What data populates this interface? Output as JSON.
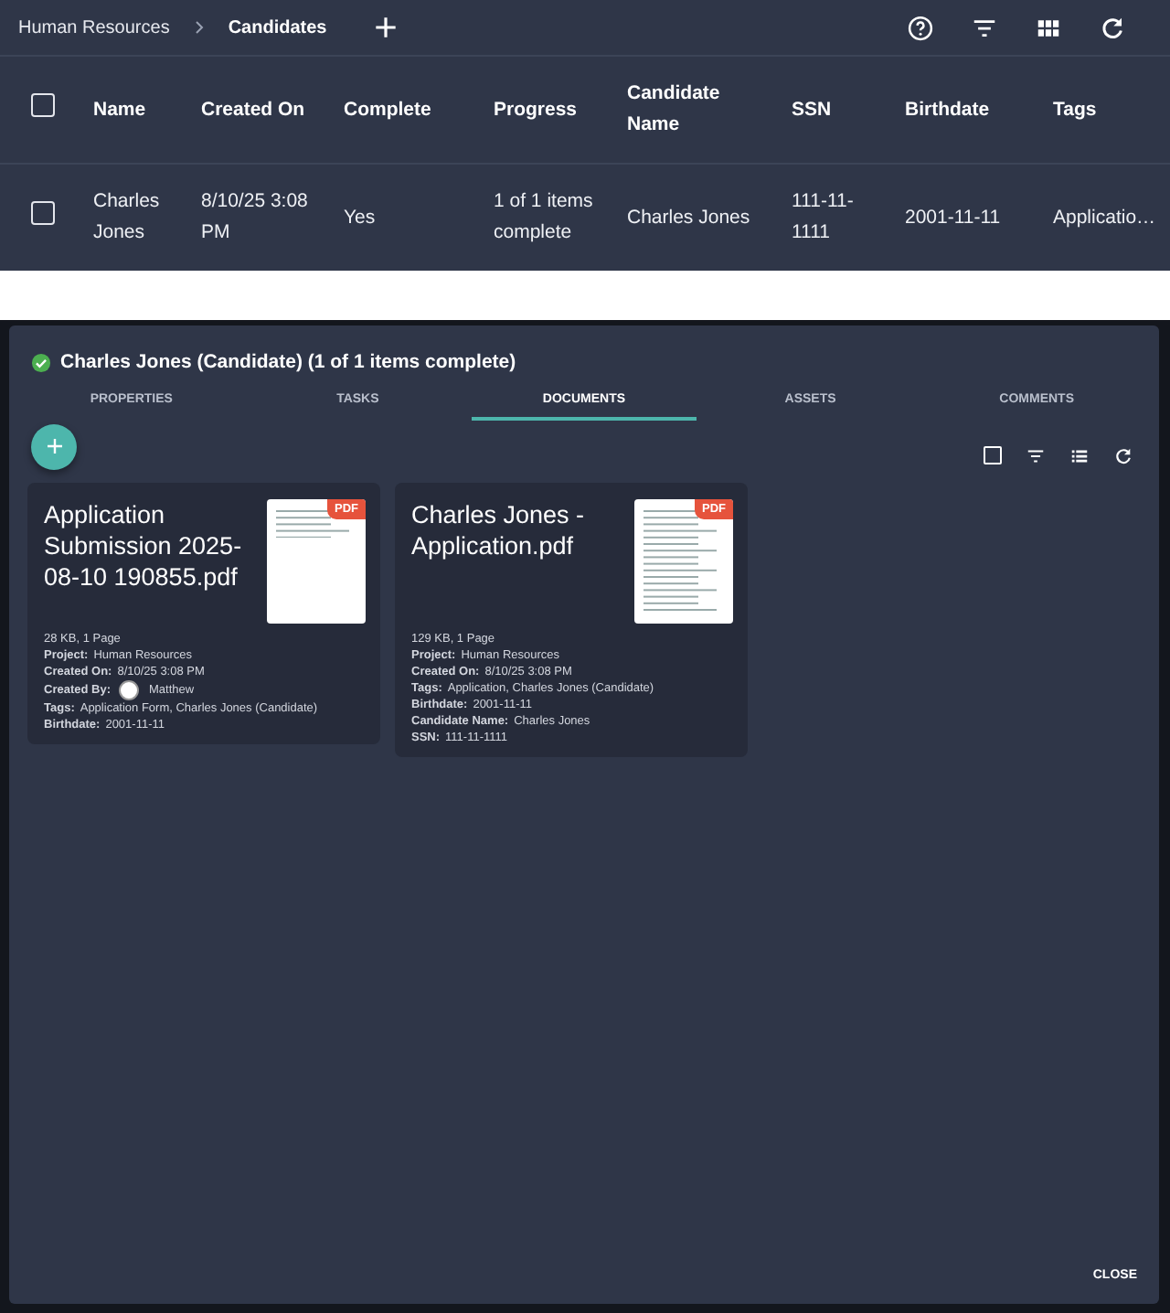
{
  "breadcrumb": [
    {
      "label": "Human Resources"
    },
    {
      "label": "Candidates"
    }
  ],
  "table": {
    "all_selected": false,
    "columns": [
      "Name",
      "Created On",
      "Complete",
      "Progress",
      "Candidate Name",
      "SSN",
      "Birthdate",
      "Tags"
    ],
    "rows": [
      {
        "selected": false,
        "cells": [
          "Charles Jones",
          "8/10/25 3:08 PM",
          "Yes",
          "1 of 1 items complete",
          "Charles Jones",
          "111-11-1111",
          "2001-11-11",
          "Applicatio…"
        ]
      }
    ]
  },
  "dialog": {
    "all_selected": false,
    "title": "Charles Jones (Candidate) (1 of 1 items complete)",
    "complete": true,
    "tabs": [
      {
        "label": "PROPERTIES",
        "selected": false
      },
      {
        "label": "TASKS",
        "selected": false
      },
      {
        "label": "DOCUMENTS",
        "selected": true
      },
      {
        "label": "ASSETS",
        "selected": false
      },
      {
        "label": "COMMENTS",
        "selected": false
      }
    ],
    "documents": [
      {
        "title": "Application Submission 2025-08-10 190855.pdf",
        "badge": "PDF",
        "details": [
          {
            "kind": "plain",
            "value": "28 KB, 1 Page"
          },
          {
            "kind": "field",
            "label": "Project:",
            "value": "Human Resources"
          },
          {
            "kind": "field",
            "label": "Created On:",
            "value": "8/10/25 3:08 PM"
          },
          {
            "kind": "user",
            "label": "Created By:",
            "value": "Matthew"
          },
          {
            "kind": "field",
            "label": "Tags:",
            "value": "Application Form, Charles Jones (Candidate)"
          },
          {
            "kind": "field",
            "label": "Birthdate:",
            "value": "2001-11-11"
          }
        ]
      },
      {
        "title": "Charles Jones - Application.pdf",
        "badge": "PDF",
        "details": [
          {
            "kind": "plain",
            "value": "129 KB, 1 Page"
          },
          {
            "kind": "field",
            "label": "Project:",
            "value": "Human Resources"
          },
          {
            "kind": "field",
            "label": "Created On:",
            "value": "8/10/25 3:08 PM"
          },
          {
            "kind": "field",
            "label": "Tags:",
            "value": "Application, Charles Jones (Candidate)"
          },
          {
            "kind": "field",
            "label": "Birthdate:",
            "value": "2001-11-11"
          },
          {
            "kind": "field",
            "label": "Candidate Name:",
            "value": "Charles Jones"
          },
          {
            "kind": "field",
            "label": "SSN:",
            "value": "111-11-1111"
          }
        ]
      }
    ],
    "close": "CLOSE"
  }
}
